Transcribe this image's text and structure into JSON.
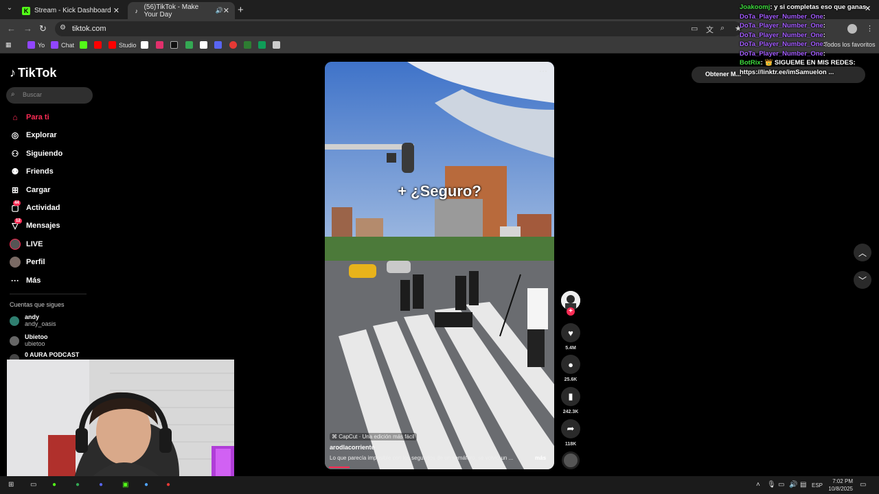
{
  "browser": {
    "tabs": [
      {
        "title": "Stream - Kick Dashboard",
        "icon": "kick-icon"
      },
      {
        "title": "(56)TikTok - Make Your Day",
        "icon": "tiktok-icon",
        "audio": "speaker-icon"
      }
    ],
    "url": "tiktok.com",
    "bookmarks": [
      {
        "label": "Yo",
        "color": "#9146ff"
      },
      {
        "label": "Chat",
        "color": "#9146ff"
      },
      {
        "label": "",
        "color": "#53fc18"
      },
      {
        "label": "",
        "color": "#ff0000"
      },
      {
        "label": "Studio",
        "color": "#ff0000"
      },
      {
        "label": "",
        "color": "#ffffff"
      },
      {
        "label": "",
        "color": "#e1306c"
      },
      {
        "label": "",
        "color": "#111111"
      },
      {
        "label": "",
        "color": "#34a853"
      },
      {
        "label": "",
        "color": "#ffffff"
      },
      {
        "label": "",
        "color": "#5865f2"
      },
      {
        "label": "",
        "color": "#e53935"
      },
      {
        "label": "",
        "color": "#2e7d32"
      },
      {
        "label": "",
        "color": "#0f9d58"
      },
      {
        "label": "",
        "color": "#cccccc"
      }
    ],
    "all_bookmarks": "Todos los favoritos"
  },
  "sidebar": {
    "logo": "TikTok",
    "search_placeholder": "Buscar",
    "nav": [
      {
        "label": "Para ti",
        "icon": "home-icon",
        "active": true
      },
      {
        "label": "Explorar",
        "icon": "compass-icon"
      },
      {
        "label": "Siguiendo",
        "icon": "following-icon"
      },
      {
        "label": "Friends",
        "icon": "friends-icon"
      },
      {
        "label": "Cargar",
        "icon": "upload-icon"
      },
      {
        "label": "Actividad",
        "icon": "activity-icon",
        "badge": "44"
      },
      {
        "label": "Mensajes",
        "icon": "messages-icon",
        "badge": "12"
      },
      {
        "label": "LIVE",
        "icon": "live-icon"
      },
      {
        "label": "Perfil",
        "icon": "profile-icon"
      },
      {
        "label": "Más",
        "icon": "more-icon"
      }
    ],
    "following_title": "Cuentas que sigues",
    "following": [
      {
        "name": "andy",
        "handle": "andy_oasis"
      },
      {
        "name": "Ubietoo",
        "handle": "ubietoo"
      },
      {
        "name": "0 AURA PODCAST",
        "handle": ""
      }
    ]
  },
  "video": {
    "overlay_text": "+ ¿Seguro?",
    "capcut": "CapCut · Una edición más fácil",
    "author": "arodlacorriente",
    "description": "Lo que parecía imposible con los segundos de un semáforo, se volvió un ...",
    "more": "más",
    "progress": 0.09
  },
  "actions": {
    "likes": "5.4M",
    "comments": "25.6K",
    "saves": "242.3K",
    "shares": "118K"
  },
  "get_app": "Obtener M...",
  "chat": [
    {
      "user": "Joakoomj",
      "msg": "y si completas eso que ganas",
      "color": "#3ddc3d"
    },
    {
      "user": "DoTa_Player_Number_One",
      "msg": "",
      "color": "#a35cff"
    },
    {
      "user": "DoTa_Player_Number_One",
      "msg": "",
      "color": "#a35cff"
    },
    {
      "user": "DoTa_Player_Number_One",
      "msg": "",
      "color": "#a35cff"
    },
    {
      "user": "DoTa_Player_Number_One",
      "msg": "",
      "color": "#a35cff"
    },
    {
      "user": "DoTa_Player_Number_One",
      "msg": "",
      "color": "#a35cff"
    },
    {
      "user": "BotRix",
      "msg": "👑 SIGUEME EN MIS REDES:",
      "color": "#3ddc3d"
    },
    {
      "user": "",
      "msg": "https://linktr.ee/imSamuelon ...",
      "color": "#ffffff"
    }
  ],
  "taskbar": {
    "language": "ESP",
    "time": "7:02 PM",
    "date": "10/8/2025"
  },
  "colors": {
    "accent": "#fe2c55",
    "kick": "#53fc18"
  }
}
